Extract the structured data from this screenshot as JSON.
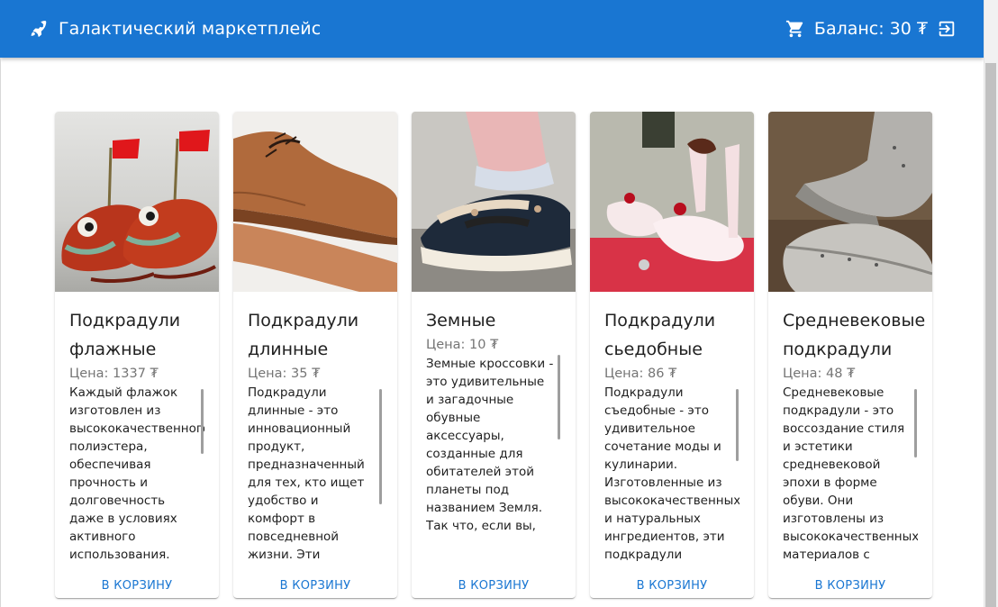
{
  "header": {
    "title": "Галактический маркетплейс",
    "balance": "Баланс: 30 ₮",
    "icons": {
      "logo": "rocket-icon",
      "cart": "shopping-cart-icon",
      "logout": "logout-icon"
    },
    "background": "#1976d2"
  },
  "products": [
    {
      "name": "Подкрадули флажные",
      "price": "Цена: 1337 ₮",
      "description": "Каждый флажок изготовлен из высококачественного полиэстера, обеспечивая прочность и долговечность даже в условиях активного использования. Они легкие и компактные,",
      "button": "В КОРЗИНУ"
    },
    {
      "name": "Подкрадули длинные",
      "price": "Цена: 35 ₮",
      "description": "Подкрадули длинные - это инновационный продукт, предназначенный для тех, кто ищет удобство и комфорт в повседневной жизни. Эти удлиненные подкрадули сочетают",
      "button": "В КОРЗИНУ"
    },
    {
      "name": "Земные",
      "price": "Цена: 10 ₮",
      "description": "Земные кроссовки - это удивительные и загадочные обувные аксессуары, созданные для обитателей этой планеты под названием Земля. Так что, если вы, земляне, ищете",
      "button": "В КОРЗИНУ"
    },
    {
      "name": "Подкрадули сьедобные",
      "price": "Цена: 86 ₮",
      "description": "Подкрадули съедобные - это удивительное сочетание моды и кулинарии. Изготовленные из высококачественных и натуральных ингредиентов, эти подкрадули",
      "button": "В КОРЗИНУ"
    },
    {
      "name": "Средневековые подкрадули",
      "price": "Цена: 48 ₮",
      "description": "Средневековые подкрадули - это воссоздание стиля и эстетики средневековой эпохи в форме обуви. Они изготовлены из высококачественных материалов с использованием",
      "button": "В КОРЗИНУ"
    }
  ]
}
